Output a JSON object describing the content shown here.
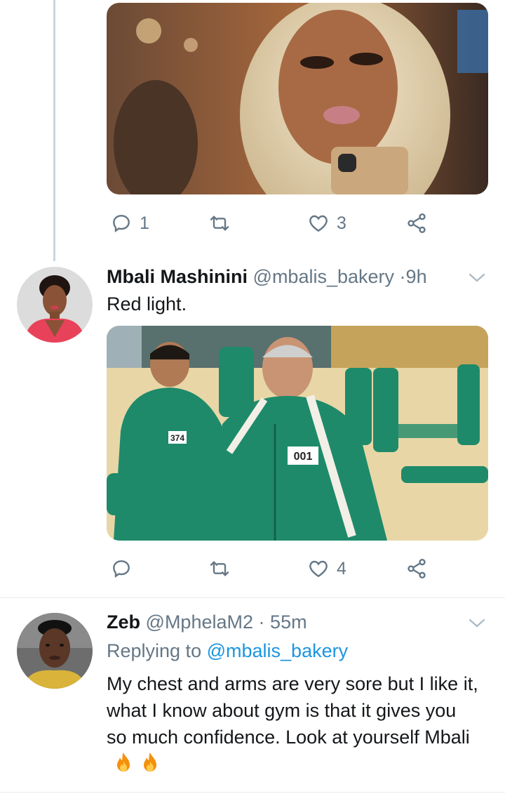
{
  "tweet1": {
    "actions": {
      "reply_count": "1",
      "retweet_count": "",
      "like_count": "3"
    }
  },
  "tweet2": {
    "display_name": "Mbali Mashinini",
    "handle": "@mbalis_bakery",
    "separator": "·",
    "time": "9h",
    "text": "Red light.",
    "image_label_left": "374",
    "image_label_right": "001",
    "actions": {
      "reply_count": "",
      "retweet_count": "",
      "like_count": "4"
    }
  },
  "tweet3": {
    "display_name": "Zeb",
    "handle": "@MphelaM2",
    "separator": "·",
    "time": "55m",
    "replying_prefix": "Replying to",
    "replying_to": "@mbalis_bakery",
    "text": "My chest and arms are very sore but I like it, what I know about gym is that it gives you so much confidence. Look at yourself Mbali"
  },
  "icons": {
    "reply": "reply-icon",
    "retweet": "retweet-icon",
    "like": "heart-icon",
    "share": "share-icon",
    "more": "chevron-down-icon",
    "emoji": "fire-emoji"
  },
  "colors": {
    "text": "#14171a",
    "muted": "#657786",
    "link": "#1b95e0",
    "thread_line": "#ccd6dd",
    "tracksuit_green": "#1e8a6a"
  }
}
